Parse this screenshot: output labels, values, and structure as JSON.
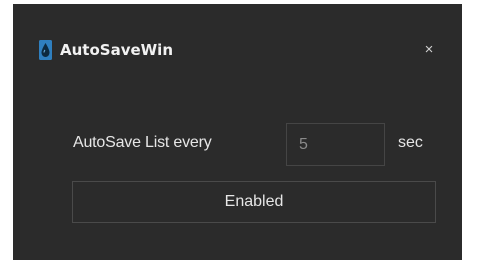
{
  "window": {
    "title": "AutoSaveWin",
    "icon": "water-drop-icon",
    "close_glyph": "×",
    "background": "#2b2b2b"
  },
  "autosave": {
    "label": "AutoSave List every",
    "interval_value": "5",
    "unit": "sec"
  },
  "toggle": {
    "label": "Enabled"
  }
}
